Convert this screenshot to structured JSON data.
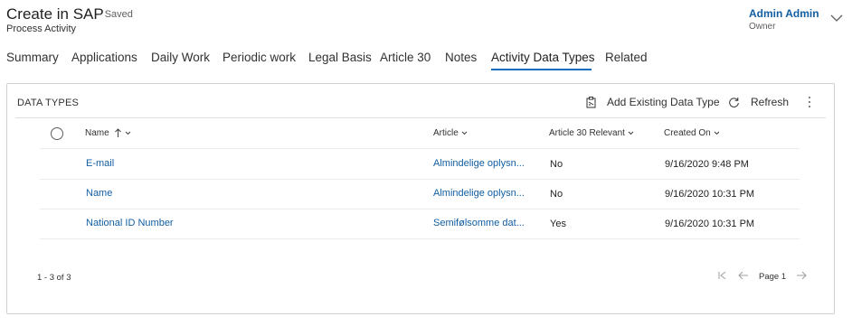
{
  "header": {
    "title": "Create in SAP",
    "saved_status": "- Saved",
    "entity_type": "Process Activity",
    "owner_name": "Admin Admin",
    "owner_label": "Owner"
  },
  "tabs": [
    {
      "label": "Summary"
    },
    {
      "label": "Applications"
    },
    {
      "label": "Daily Work"
    },
    {
      "label": "Periodic work"
    },
    {
      "label": "Legal Basis"
    },
    {
      "label": "Article 30"
    },
    {
      "label": "Notes"
    },
    {
      "label": "Activity Data Types",
      "active": true
    },
    {
      "label": "Related"
    }
  ],
  "panel": {
    "title": "DATA TYPES",
    "add_existing_label": "Add Existing Data Type",
    "refresh_label": "Refresh"
  },
  "table": {
    "columns": [
      "Name",
      "Article",
      "Article 30 Relevant",
      "Created On"
    ],
    "rows": [
      {
        "name": "E-mail",
        "article": "Almindelige oplysn...",
        "relevant": "No",
        "created": "9/16/2020 9:48 PM"
      },
      {
        "name": "Name",
        "article": "Almindelige oplysn...",
        "relevant": "No",
        "created": "9/16/2020 10:31 PM"
      },
      {
        "name": "National ID Number",
        "article": "Semifølsomme dat...",
        "relevant": "Yes",
        "created": "9/16/2020 10:31 PM"
      }
    ]
  },
  "footer": {
    "record_count": "1 - 3 of 3",
    "page_label": "Page 1"
  },
  "colors": {
    "accent": "#0f6cbd",
    "link": "#115ea3",
    "border": "#d1d1d1"
  },
  "icons": {
    "expand": "chevron-down-icon",
    "add_existing": "clipboard-icon",
    "refresh": "refresh-icon",
    "more": "more-vertical-icon",
    "sort": "arrow-up-icon",
    "first_page": "first-page-icon",
    "prev_page": "arrow-left-icon",
    "next_page": "arrow-right-icon"
  }
}
